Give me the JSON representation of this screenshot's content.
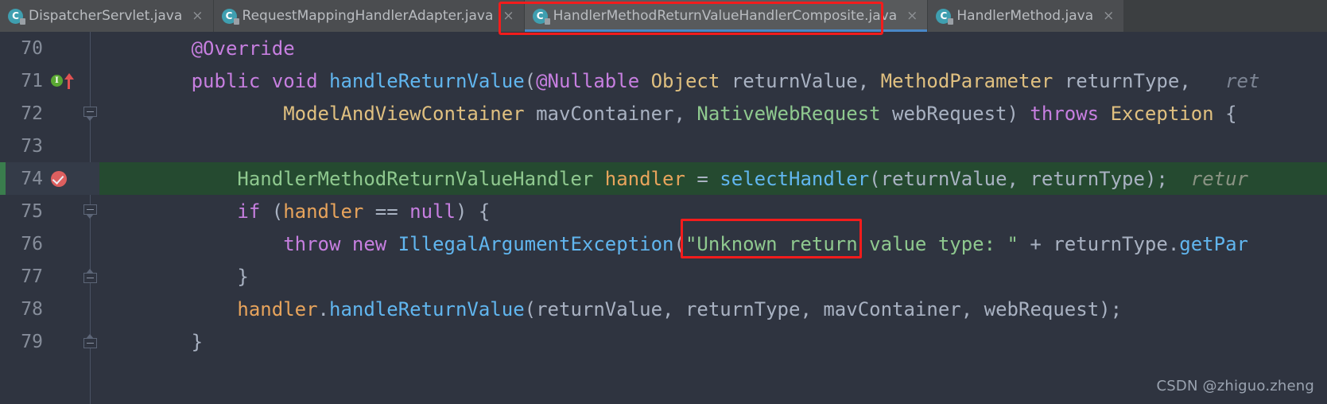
{
  "editor": {
    "theme_colors": {
      "background": "#2f3440",
      "tabbar_background": "#3c3f41",
      "active_tab_underline": "#4a88c7",
      "annotation_box": "#f31c1c",
      "added_line_background": "#254a30",
      "current_line_background": "#343b48",
      "keyword": "#c77fe0",
      "method": "#61b6ef",
      "class_type": "#e0c080",
      "interface_type": "#8fc98f",
      "string": "#8fc98f",
      "local_variable": "#e8a45c",
      "identifier": "#a9b2c2",
      "inlay_hint": "#7d8594",
      "line_number": "#868d9a"
    },
    "tabs": [
      {
        "label": "DispatcherServlet.java",
        "icon": "java-class-icon",
        "close_icon": "×",
        "active": false
      },
      {
        "label": "RequestMappingHandlerAdapter.java",
        "icon": "java-class-icon",
        "close_icon": "×",
        "active": false
      },
      {
        "label": "HandlerMethodReturnValueHandlerComposite.java",
        "icon": "java-class-icon",
        "close_icon": "×",
        "active": true
      },
      {
        "label": "HandlerMethod.java",
        "icon": "java-class-icon",
        "close_icon": "×",
        "active": false
      }
    ],
    "gutter_icons": {
      "override_marker": "I",
      "breakpoint_verified": "breakpoint-checked-icon",
      "run_arrow": "red-up-arrow-icon"
    },
    "lines": [
      {
        "number": "70",
        "markers": [],
        "fold": null,
        "state": "normal",
        "tokens": [
          {
            "t": "        ",
            "c": "pun"
          },
          {
            "t": "@Override",
            "c": "anno"
          }
        ]
      },
      {
        "number": "71",
        "markers": [
          "override-marker",
          "run-arrow"
        ],
        "fold": null,
        "state": "normal",
        "tokens": [
          {
            "t": "        ",
            "c": "pun"
          },
          {
            "t": "public",
            "c": "kw"
          },
          {
            "t": " ",
            "c": "pun"
          },
          {
            "t": "void",
            "c": "kw"
          },
          {
            "t": " ",
            "c": "pun"
          },
          {
            "t": "handleReturnValue",
            "c": "mth"
          },
          {
            "t": "(",
            "c": "pun"
          },
          {
            "t": "@Nullable",
            "c": "anno"
          },
          {
            "t": " ",
            "c": "pun"
          },
          {
            "t": "Object",
            "c": "cls"
          },
          {
            "t": " ",
            "c": "pun"
          },
          {
            "t": "returnValue",
            "c": "var"
          },
          {
            "t": ", ",
            "c": "pun"
          },
          {
            "t": "MethodParameter",
            "c": "cls"
          },
          {
            "t": " ",
            "c": "pun"
          },
          {
            "t": "returnType",
            "c": "var"
          },
          {
            "t": ",   ",
            "c": "pun"
          },
          {
            "t": "ret",
            "c": "hint"
          }
        ]
      },
      {
        "number": "72",
        "markers": [],
        "fold": "down",
        "state": "normal",
        "tokens": [
          {
            "t": "                ",
            "c": "pun"
          },
          {
            "t": "ModelAndViewContainer",
            "c": "cls"
          },
          {
            "t": " ",
            "c": "pun"
          },
          {
            "t": "mavContainer",
            "c": "var"
          },
          {
            "t": ", ",
            "c": "pun"
          },
          {
            "t": "NativeWebRequest",
            "c": "iface"
          },
          {
            "t": " ",
            "c": "pun"
          },
          {
            "t": "webRequest",
            "c": "var"
          },
          {
            "t": ") ",
            "c": "pun"
          },
          {
            "t": "throws",
            "c": "kw"
          },
          {
            "t": " ",
            "c": "pun"
          },
          {
            "t": "Exception",
            "c": "cls"
          },
          {
            "t": " {",
            "c": "pun"
          }
        ]
      },
      {
        "number": "73",
        "markers": [],
        "fold": null,
        "state": "normal",
        "tokens": []
      },
      {
        "number": "74",
        "markers": [
          "breakpoint-verified"
        ],
        "fold": null,
        "state": "added-current",
        "tokens": [
          {
            "t": "            ",
            "c": "pun"
          },
          {
            "t": "HandlerMethodReturnValueHandler",
            "c": "iface"
          },
          {
            "t": " ",
            "c": "pun"
          },
          {
            "t": "handler",
            "c": "lvar"
          },
          {
            "t": " = ",
            "c": "pun"
          },
          {
            "t": "selectHandler",
            "c": "mth"
          },
          {
            "t": "(",
            "c": "pun"
          },
          {
            "t": "returnValue",
            "c": "var"
          },
          {
            "t": ", ",
            "c": "pun"
          },
          {
            "t": "returnType",
            "c": "var"
          },
          {
            "t": ");  ",
            "c": "pun"
          },
          {
            "t": "retur",
            "c": "hint"
          }
        ]
      },
      {
        "number": "75",
        "markers": [],
        "fold": "down",
        "state": "normal",
        "tokens": [
          {
            "t": "            ",
            "c": "pun"
          },
          {
            "t": "if",
            "c": "kw"
          },
          {
            "t": " (",
            "c": "pun"
          },
          {
            "t": "handler",
            "c": "lvar"
          },
          {
            "t": " == ",
            "c": "pun"
          },
          {
            "t": "null",
            "c": "kw"
          },
          {
            "t": ") {",
            "c": "pun"
          }
        ]
      },
      {
        "number": "76",
        "markers": [],
        "fold": null,
        "state": "normal",
        "tokens": [
          {
            "t": "                ",
            "c": "pun"
          },
          {
            "t": "throw",
            "c": "kw"
          },
          {
            "t": " ",
            "c": "pun"
          },
          {
            "t": "new",
            "c": "kw"
          },
          {
            "t": " ",
            "c": "pun"
          },
          {
            "t": "IllegalArgumentException",
            "c": "mth"
          },
          {
            "t": "(",
            "c": "pun"
          },
          {
            "t": "\"Unknown return value type: \"",
            "c": "str"
          },
          {
            "t": " + ",
            "c": "pun"
          },
          {
            "t": "returnType",
            "c": "var"
          },
          {
            "t": ".",
            "c": "pun"
          },
          {
            "t": "getPar",
            "c": "mth"
          }
        ]
      },
      {
        "number": "77",
        "markers": [],
        "fold": "up",
        "state": "normal",
        "tokens": [
          {
            "t": "            }",
            "c": "pun"
          }
        ]
      },
      {
        "number": "78",
        "markers": [],
        "fold": null,
        "state": "normal",
        "tokens": [
          {
            "t": "            ",
            "c": "pun"
          },
          {
            "t": "handler",
            "c": "lvar"
          },
          {
            "t": ".",
            "c": "pun"
          },
          {
            "t": "handleReturnValue",
            "c": "mth"
          },
          {
            "t": "(",
            "c": "pun"
          },
          {
            "t": "returnValue",
            "c": "var"
          },
          {
            "t": ", ",
            "c": "pun"
          },
          {
            "t": "returnType",
            "c": "var"
          },
          {
            "t": ", ",
            "c": "pun"
          },
          {
            "t": "mavContainer",
            "c": "var"
          },
          {
            "t": ", ",
            "c": "pun"
          },
          {
            "t": "webRequest",
            "c": "var"
          },
          {
            "t": ");",
            "c": "pun"
          }
        ]
      },
      {
        "number": "79",
        "markers": [],
        "fold": "up",
        "state": "normal",
        "tokens": [
          {
            "t": "        }",
            "c": "pun"
          }
        ]
      }
    ],
    "annotations": [
      {
        "name": "active-tab-highlight",
        "target": "HandlerMethodReturnValueHandlerComposite.java"
      },
      {
        "name": "selectHandler-highlight",
        "target": "selectHandler"
      }
    ]
  },
  "watermark": {
    "text": "CSDN @zhiguo.zheng"
  }
}
